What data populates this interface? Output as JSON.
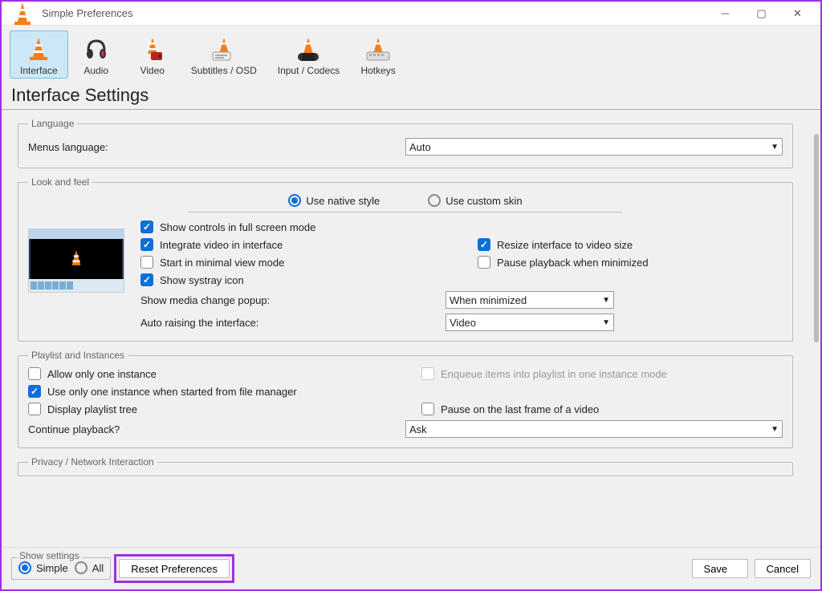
{
  "window": {
    "title": "Simple Preferences"
  },
  "categories": [
    {
      "label": "Interface",
      "active": true
    },
    {
      "label": "Audio",
      "active": false
    },
    {
      "label": "Video",
      "active": false
    },
    {
      "label": "Subtitles / OSD",
      "active": false
    },
    {
      "label": "Input / Codecs",
      "active": false
    },
    {
      "label": "Hotkeys",
      "active": false
    }
  ],
  "page_title": "Interface Settings",
  "language": {
    "legend": "Language",
    "label": "Menus language:",
    "value": "Auto"
  },
  "lookfeel": {
    "legend": "Look and feel",
    "style_native": "Use native style",
    "style_custom": "Use custom skin",
    "style_selected": "native",
    "chk_fullscreen": "Show controls in full screen mode",
    "chk_integrate": "Integrate video in interface",
    "chk_resize": "Resize interface to video size",
    "chk_minimal": "Start in minimal view mode",
    "chk_pause_min": "Pause playback when minimized",
    "chk_systray": "Show systray icon",
    "lbl_popup": "Show media change popup:",
    "val_popup": "When minimized",
    "lbl_autoraise": "Auto raising the interface:",
    "val_autoraise": "Video",
    "checked": {
      "fullscreen": true,
      "integrate": true,
      "resize": true,
      "minimal": false,
      "pause_min": false,
      "systray": true
    }
  },
  "playlist": {
    "legend": "Playlist and Instances",
    "chk_one_instance": "Allow only one instance",
    "chk_enqueue": "Enqueue items into playlist in one instance mode",
    "chk_one_filemgr": "Use only one instance when started from file manager",
    "chk_display_tree": "Display playlist tree",
    "chk_pause_last": "Pause on the last frame of a video",
    "lbl_continue": "Continue playback?",
    "val_continue": "Ask",
    "checked": {
      "one_instance": false,
      "enqueue": false,
      "one_filemgr": true,
      "display_tree": false,
      "pause_last": false
    },
    "disabled": {
      "enqueue": true
    }
  },
  "privacy": {
    "legend": "Privacy / Network Interaction"
  },
  "bottom": {
    "show_settings_legend": "Show settings",
    "simple": "Simple",
    "all": "All",
    "selected": "simple",
    "reset": "Reset Preferences",
    "save": "Save",
    "cancel": "Cancel"
  }
}
